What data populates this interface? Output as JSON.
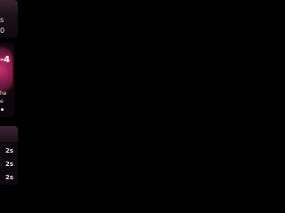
{
  "sidebar": {
    "top_card": {
      "line1": "s",
      "line2": "0"
    },
    "player_card": {
      "score": "-4",
      "caption": "he",
      "sub_caption": "e"
    },
    "timer_list": {
      "items": [
        {
          "label": "2s"
        },
        {
          "label": "2s"
        },
        {
          "label": "2s"
        }
      ]
    }
  },
  "colors": {
    "accent": "#c93370",
    "background": "#020102"
  }
}
